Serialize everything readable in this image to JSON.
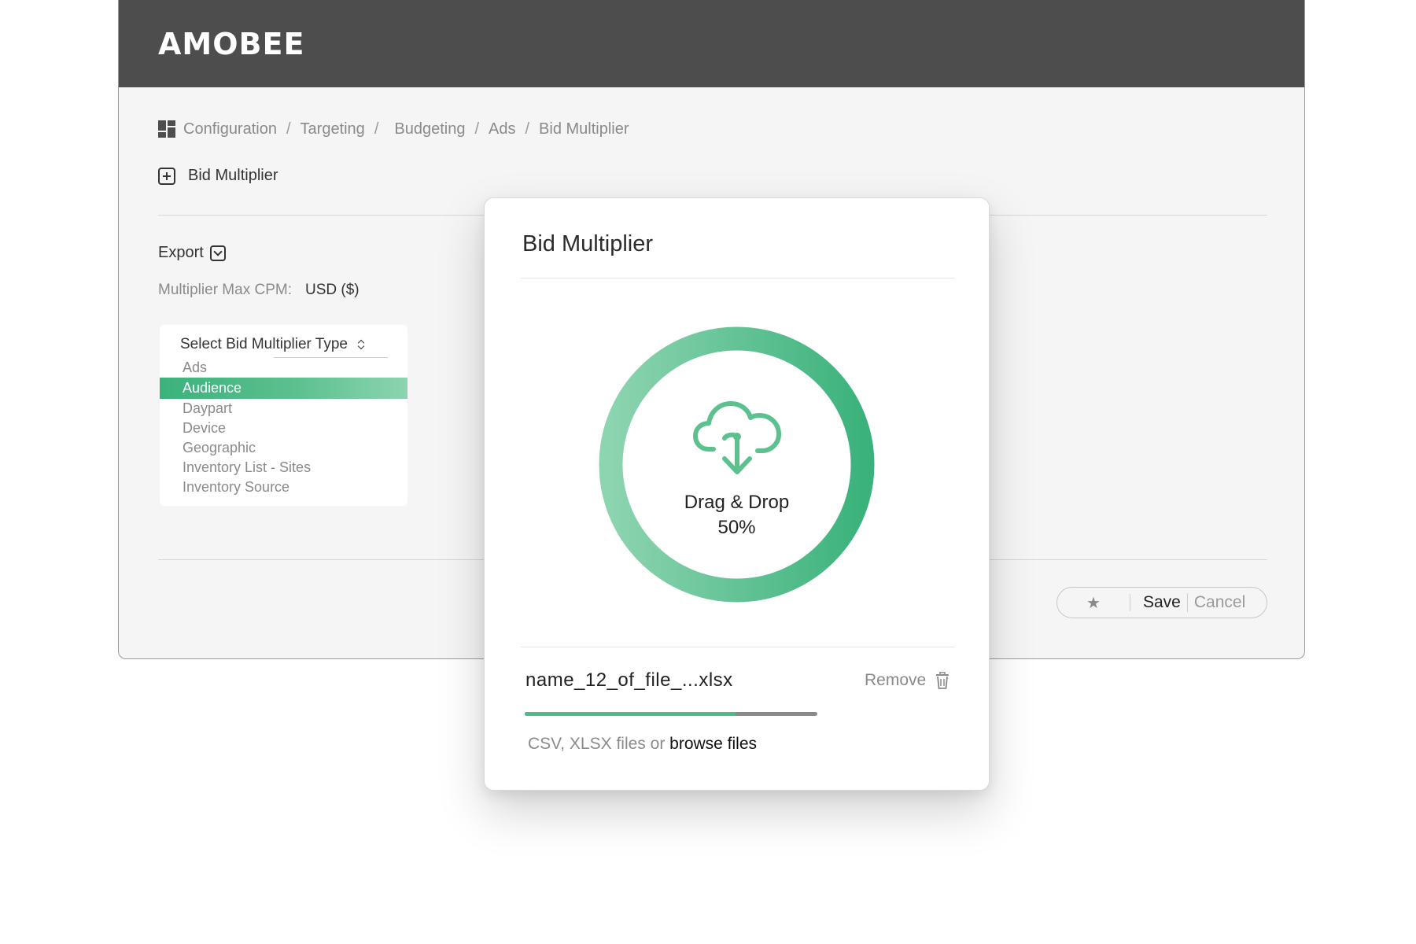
{
  "app": {
    "brand": "AMOBEE"
  },
  "breadcrumb": {
    "items": [
      "Configuration",
      "Targeting",
      "Budgeting",
      "Ads",
      "Bid Multiplier"
    ],
    "separator": "/"
  },
  "page": {
    "section_title": "Bid Multiplier",
    "export_label": "Export",
    "cpm_label": "Multiplier Max CPM:",
    "cpm_value": "USD ($)"
  },
  "type_selector": {
    "label": "Select Bid Multiplier Type",
    "options": [
      "Ads",
      "Audience",
      "Daypart",
      "Device",
      "Geographic",
      "Inventory List - Sites",
      "Inventory Source"
    ],
    "selected": "Audience"
  },
  "actions": {
    "save_label": "Save",
    "cancel_label": "Cancel",
    "favorite_icon": "star-icon"
  },
  "modal": {
    "title": "Bid Multiplier",
    "drop_label": "Drag & Drop",
    "progress_text": "50%",
    "progress_fraction": 0.5,
    "file_name": "name_12_of_file_...xlsx",
    "remove_label": "Remove",
    "upload_progress_fraction": 0.72,
    "hint_prefix": "CSV, XLSX files or",
    "browse_label": "browse files"
  },
  "colors": {
    "accent_green": "#3bb27c",
    "accent_green_light": "#8dd4b1",
    "header_bg": "#4d4d4d",
    "muted_text": "#8a8a8a"
  }
}
